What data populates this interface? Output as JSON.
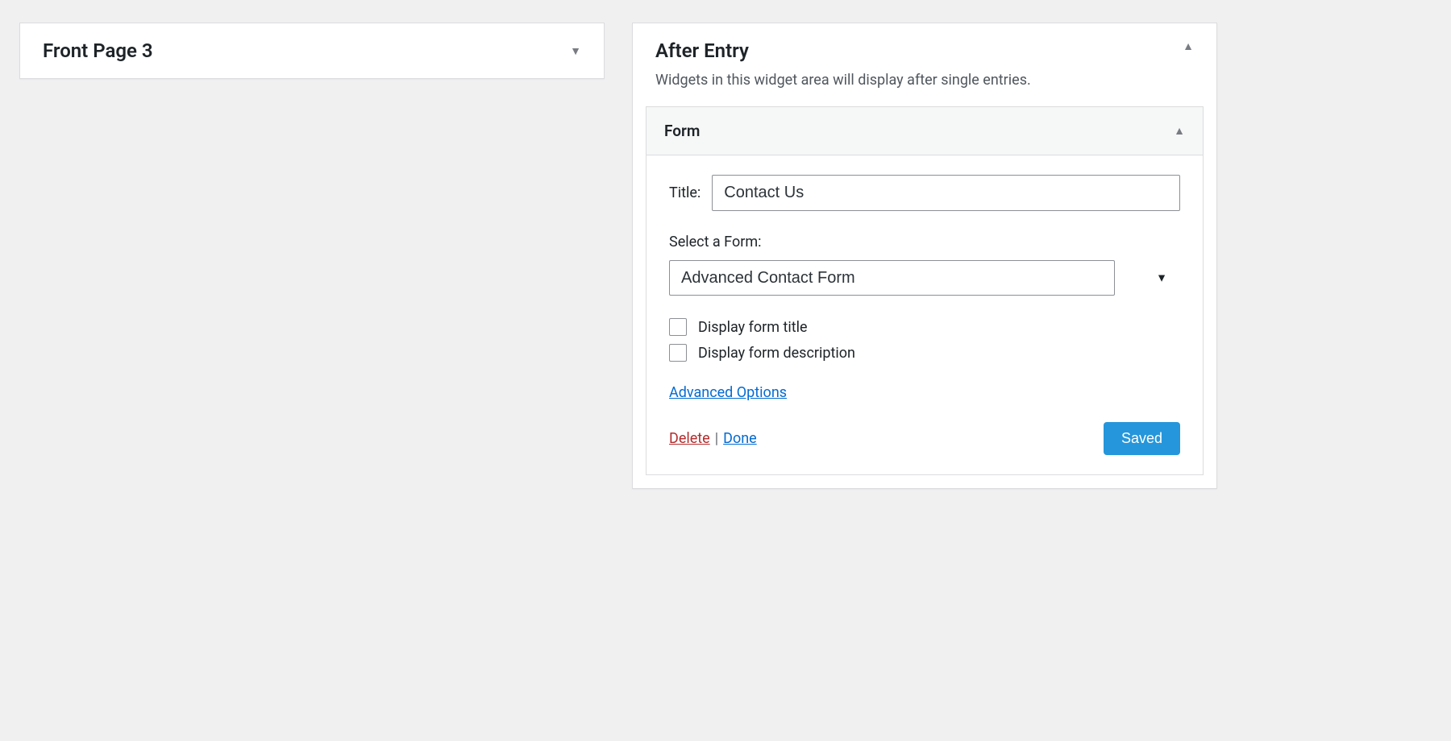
{
  "left": {
    "title": "Front Page 3"
  },
  "right": {
    "title": "After Entry",
    "description": "Widgets in this widget area will display after single entries.",
    "widget": {
      "name": "Form",
      "title_label": "Title:",
      "title_value": "Contact Us",
      "select_label": "Select a Form:",
      "select_value": "Advanced Contact Form",
      "checkbox1_label": "Display form title",
      "checkbox2_label": "Display form description",
      "advanced_link": "Advanced Options",
      "delete_label": "Delete",
      "done_label": "Done",
      "saved_label": "Saved"
    }
  }
}
